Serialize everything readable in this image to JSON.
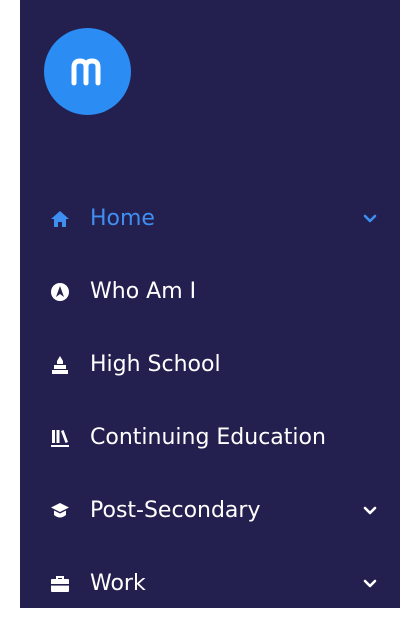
{
  "colors": {
    "background": "#23204f",
    "accent": "#3f8ff2",
    "logo": "#2b8cf4",
    "text": "#ffffff"
  },
  "logo": {
    "icon": "m-logo-icon"
  },
  "nav": {
    "items": [
      {
        "label": "Home",
        "icon": "home-icon",
        "active": true,
        "chevron": true
      },
      {
        "label": "Who Am I",
        "icon": "compass-icon",
        "active": false,
        "chevron": false
      },
      {
        "label": "High School",
        "icon": "school-building-icon",
        "active": false,
        "chevron": false
      },
      {
        "label": "Continuing Education",
        "icon": "books-icon",
        "active": false,
        "chevron": false
      },
      {
        "label": "Post-Secondary",
        "icon": "graduation-cap-icon",
        "active": false,
        "chevron": true
      },
      {
        "label": "Work",
        "icon": "briefcase-icon",
        "active": false,
        "chevron": true
      }
    ]
  }
}
